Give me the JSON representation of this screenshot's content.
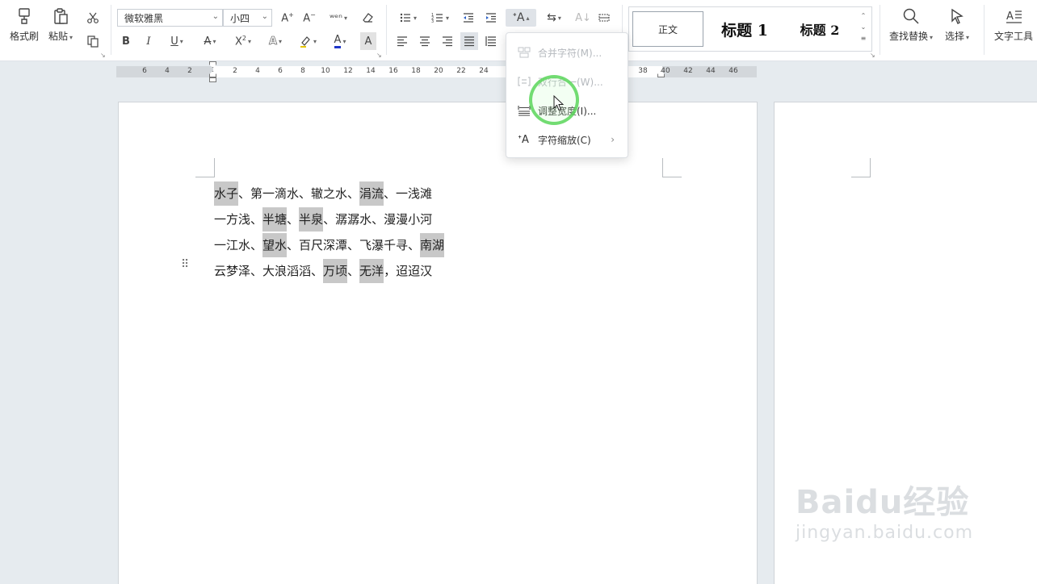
{
  "toolbar": {
    "format_painter": "格式刷",
    "paste": "粘贴",
    "font_name": "微软雅黑",
    "font_size": "小四",
    "find_replace": "查找替换",
    "select": "选择",
    "text_tools": "文字工具"
  },
  "styles": {
    "normal": "正文",
    "heading1": "标题 1",
    "heading2": "标题 2"
  },
  "ruler": {
    "ticks": [
      "6",
      "4",
      "2",
      "2",
      "4",
      "6",
      "8",
      "10",
      "12",
      "14",
      "16",
      "18",
      "20",
      "22",
      "24",
      "38",
      "40",
      "42",
      "44",
      "46"
    ]
  },
  "dropdown": {
    "items": [
      {
        "label": "合并字符(M)...",
        "icon": "merge-chars-icon",
        "enabled": false
      },
      {
        "label": "双行合一(W)...",
        "icon": "two-lines-in-one-icon",
        "enabled": false
      },
      {
        "label": "调整宽度(I)...",
        "icon": "adjust-width-icon",
        "enabled": true
      },
      {
        "label": "字符缩放(C)",
        "icon": "char-scale-icon",
        "enabled": true,
        "submenu": true
      }
    ]
  },
  "document": {
    "lines": [
      [
        {
          "t": "水子",
          "h": true
        },
        {
          "t": "、第一滴水、辙之水、"
        },
        {
          "t": "涓流",
          "h": true
        },
        {
          "t": "、一浅滩"
        }
      ],
      [
        {
          "t": "一方浅、"
        },
        {
          "t": "半塘",
          "h": true
        },
        {
          "t": "、"
        },
        {
          "t": "半泉",
          "h": true
        },
        {
          "t": "、潺潺水、漫漫小河"
        }
      ],
      [
        {
          "t": "一江水、"
        },
        {
          "t": "望水",
          "h": true
        },
        {
          "t": "、百尺深潭、飞瀑千寻、"
        },
        {
          "t": "南湖",
          "h": true
        }
      ],
      [
        {
          "t": "云梦泽、大浪滔滔、"
        },
        {
          "t": "万顷",
          "h": true
        },
        {
          "t": "、"
        },
        {
          "t": "无洋",
          "h": true
        },
        {
          "t": "，迢迢汉"
        }
      ]
    ]
  },
  "watermark": {
    "main": "Baidu经验",
    "sub": "jingyan.baidu.com"
  },
  "colors": {
    "highlight": "#c8c8c8",
    "click_ring": "#5cd65c",
    "font_color_bar": "#1f36c9"
  }
}
